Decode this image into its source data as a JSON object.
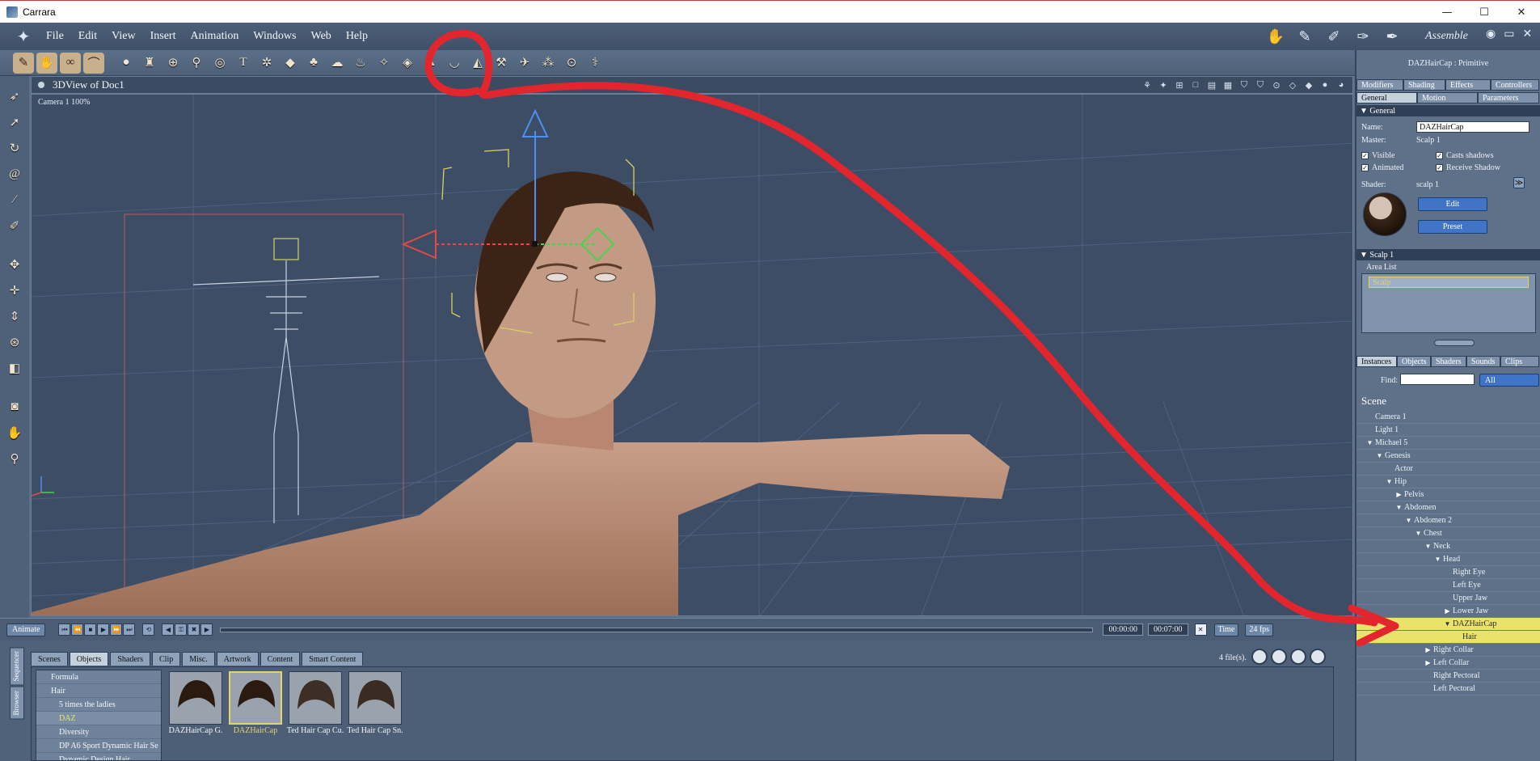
{
  "window": {
    "title": "Carrara",
    "minimize": "—",
    "maximize": "☐",
    "close": "✕"
  },
  "menu": [
    "File",
    "Edit",
    "View",
    "Insert",
    "Animation",
    "Windows",
    "Web",
    "Help"
  ],
  "room_tab_label": "Assemble",
  "view": {
    "title": "3DView of Doc1",
    "camera_label": "Camera 1 100%"
  },
  "timeline": {
    "animate_label": "Animate",
    "time_start": "00:00:00",
    "time_end": "00:07:00",
    "mode_label": "Time",
    "fps_label": "24 fps"
  },
  "browser": {
    "side_tabs": [
      "Sequencer",
      "Browser"
    ],
    "tabs": [
      "Scenes",
      "Objects",
      "Shaders",
      "Clip",
      "Misc.",
      "Artwork",
      "Content",
      "Smart Content"
    ],
    "active_tab": "Objects",
    "file_count": "4 file(s).",
    "categories": [
      {
        "label": "Formula",
        "indent": false,
        "selected": false
      },
      {
        "label": "Hair",
        "indent": false,
        "selected": false
      },
      {
        "label": "5 times the ladies",
        "indent": true,
        "selected": false
      },
      {
        "label": "DAZ",
        "indent": true,
        "selected": true
      },
      {
        "label": "Diversity",
        "indent": true,
        "selected": false
      },
      {
        "label": "DP A6 Sport Dynamic Hair Se",
        "indent": true,
        "selected": false
      },
      {
        "label": "Dynamic Design Hair",
        "indent": true,
        "selected": false
      }
    ],
    "thumbnails": [
      {
        "label": "DAZHairCap G.",
        "selected": false
      },
      {
        "label": "DAZHairCap",
        "selected": true
      },
      {
        "label": "Ted Hair Cap Cu.",
        "selected": false
      },
      {
        "label": "Ted Hair Cap Sn.",
        "selected": false
      }
    ]
  },
  "properties": {
    "header": "DAZHairCap : Primitive",
    "tabs_row1": [
      "Modifiers",
      "Shading",
      "Effects",
      "Controllers"
    ],
    "tabs_row2": [
      "General",
      "Motion",
      "Parameters"
    ],
    "section_general": "General",
    "name_label": "Name:",
    "name_value": "DAZHairCap",
    "master_label": "Master:",
    "master_value": "Scalp 1",
    "visible": "Visible",
    "casts_shadows": "Casts shadows",
    "animated": "Animated",
    "receive_shadow": "Receive Shadow",
    "shader_label": "Shader:",
    "shader_value": "scalp 1",
    "edit_button": "Edit",
    "preset_button": "Preset",
    "section_scalp": "Scalp 1",
    "area_list_label": "Area List",
    "area_item": "Scalp"
  },
  "instances": {
    "tabs": [
      "Instances",
      "Objects",
      "Shaders",
      "Sounds",
      "Clips"
    ],
    "find_label": "Find:",
    "find_value": "",
    "filter_value": "All",
    "scene_title": "Scene",
    "nodes": [
      {
        "label": "Camera 1",
        "depth": 0,
        "arrow": "",
        "selected": false
      },
      {
        "label": "Light 1",
        "depth": 0,
        "arrow": "",
        "selected": false
      },
      {
        "label": "Michael 5",
        "depth": 0,
        "arrow": "▼",
        "selected": false
      },
      {
        "label": "Genesis",
        "depth": 1,
        "arrow": "▼",
        "selected": false
      },
      {
        "label": "Actor",
        "depth": 2,
        "arrow": "",
        "selected": false
      },
      {
        "label": "Hip",
        "depth": 2,
        "arrow": "▼",
        "selected": false
      },
      {
        "label": "Pelvis",
        "depth": 3,
        "arrow": "▶",
        "selected": false
      },
      {
        "label": "Abdomen",
        "depth": 3,
        "arrow": "▼",
        "selected": false
      },
      {
        "label": "Abdomen 2",
        "depth": 4,
        "arrow": "▼",
        "selected": false
      },
      {
        "label": "Chest",
        "depth": 5,
        "arrow": "▼",
        "selected": false
      },
      {
        "label": "Neck",
        "depth": 6,
        "arrow": "▼",
        "selected": false
      },
      {
        "label": "Head",
        "depth": 7,
        "arrow": "▼",
        "selected": false
      },
      {
        "label": "Right Eye",
        "depth": 8,
        "arrow": "",
        "selected": false
      },
      {
        "label": "Left Eye",
        "depth": 8,
        "arrow": "",
        "selected": false
      },
      {
        "label": "Upper Jaw",
        "depth": 8,
        "arrow": "",
        "selected": false
      },
      {
        "label": "Lower Jaw",
        "depth": 8,
        "arrow": "▶",
        "selected": false
      },
      {
        "label": "DAZHairCap",
        "depth": 8,
        "arrow": "▼",
        "selected": true
      },
      {
        "label": "Hair",
        "depth": 9,
        "arrow": "",
        "selected": true
      },
      {
        "label": "Right Collar",
        "depth": 6,
        "arrow": "▶",
        "selected": false
      },
      {
        "label": "Left Collar",
        "depth": 6,
        "arrow": "▶",
        "selected": false
      },
      {
        "label": "Right Pectoral",
        "depth": 6,
        "arrow": "",
        "selected": false
      },
      {
        "label": "Left Pectoral",
        "depth": 6,
        "arrow": "",
        "selected": false
      }
    ]
  },
  "toolbar_icons": [
    "pencil-icon",
    "hand-icon",
    "link-icon",
    "bone-icon",
    "sphere-icon",
    "lathe-icon",
    "globe-icon",
    "skeleton-icon",
    "torus-icon",
    "text-icon",
    "gear-icon",
    "plane-icon",
    "tree-icon",
    "cloud-icon",
    "fire-icon",
    "light-icon",
    "hair-icon",
    "cone-icon",
    "bowl-icon",
    "terrain-icon",
    "cannon-icon",
    "camera-icon",
    "dots-icon",
    "target-icon",
    "wand-icon"
  ],
  "left_tool_icons": [
    "select-arrow-icon",
    "pointer-icon",
    "rotate-icon",
    "spiral-icon",
    "knife-icon",
    "paint-icon",
    "move-icon",
    "move-xz-icon",
    "move-y-icon",
    "gizmo-icon",
    "box-icon",
    "camera-icon",
    "hand-icon",
    "zoom-icon"
  ],
  "colors": {
    "annotation_red": "#e3262d",
    "selection_yellow": "#e9e26b",
    "accent_blue": "#3f74c7"
  }
}
